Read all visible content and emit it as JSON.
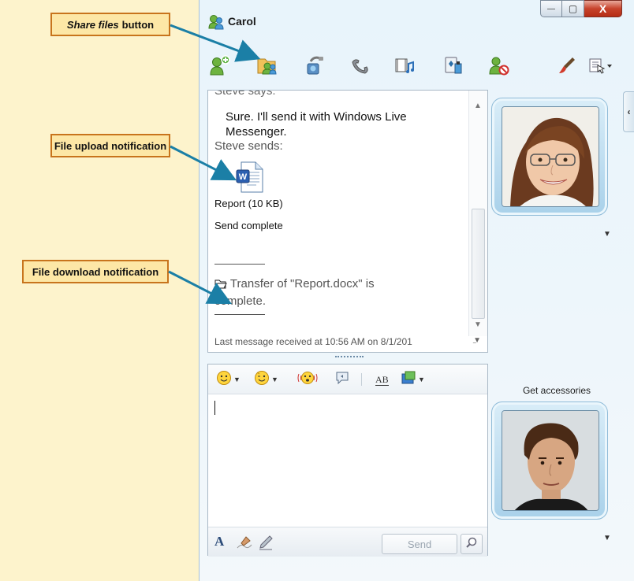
{
  "window": {
    "title": "Carol"
  },
  "caption_buttons": {
    "minimize": "—",
    "maximize": "▢",
    "close": "X"
  },
  "callouts": {
    "share": {
      "emphasis": "Share files",
      "rest": "button"
    },
    "upload": "File upload notification",
    "download": "File download notification"
  },
  "toolbar": {
    "icons": [
      "invite-contact-icon",
      "share-files-icon",
      "video-call-icon",
      "call-icon",
      "show-video-icon",
      "games-icon",
      "block-icon",
      "paint-icon",
      "menu-icon"
    ]
  },
  "conversation": {
    "partial_top": "Steve says:",
    "message_1": "Sure. I'll send it with Windows Live",
    "message_1b": "Messenger.",
    "sender_line": "Steve sends:",
    "file_name": "Report (10 KB)",
    "send_status": "Send complete",
    "transfer_notice_1": "Transfer of \"Report.docx\" is",
    "transfer_notice_2": "complete.",
    "last_message": "Last message received at 10:56 AM on 8/1/201"
  },
  "compose": {
    "send_label": "Send",
    "format_font_glyph": "A",
    "spell_glyph": "AB"
  },
  "right_panel": {
    "accessories_label": "Get accessories",
    "collapse_glyph": "‹"
  },
  "colors": {
    "callout_bg": "#fde7a6",
    "callout_border": "#c8741c",
    "arrow": "#1b7fa6",
    "page_bg": "#fdf3cc"
  }
}
